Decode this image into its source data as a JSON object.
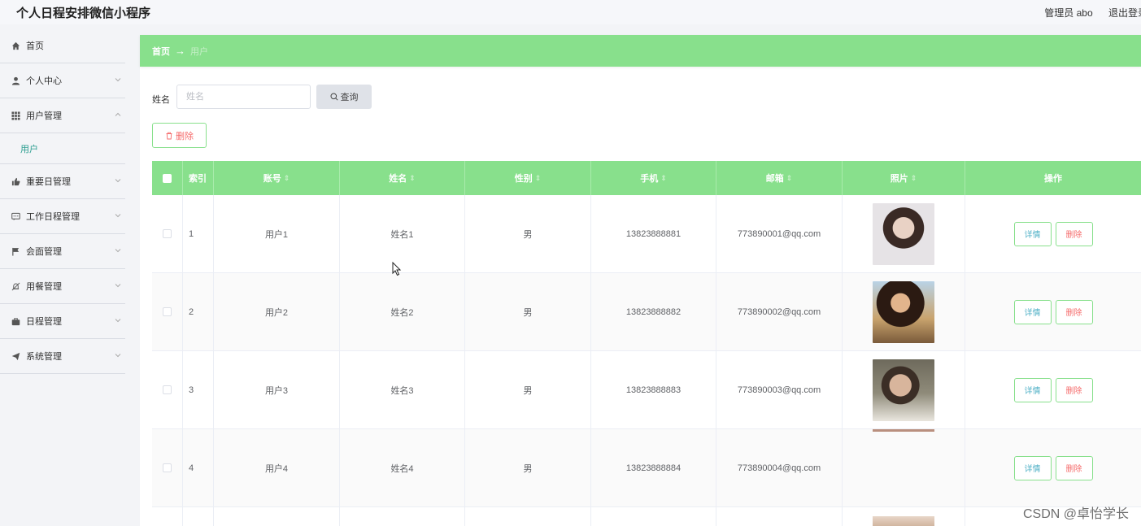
{
  "app": {
    "title": "个人日程安排微信小程序",
    "admin": "管理员 abo",
    "logout": "退出登录"
  },
  "sidebar": {
    "items": [
      {
        "label": "首页",
        "icon": "home-icon"
      },
      {
        "label": "个人中心",
        "icon": "user-icon"
      },
      {
        "label": "用户管理",
        "icon": "grid-icon",
        "expanded": true,
        "sub": [
          "用户"
        ]
      },
      {
        "label": "重要日管理",
        "icon": "thumb-icon"
      },
      {
        "label": "工作日程管理",
        "icon": "chat-icon"
      },
      {
        "label": "会面管理",
        "icon": "flag-icon"
      },
      {
        "label": "用餐管理",
        "icon": "bell-off-icon"
      },
      {
        "label": "日程管理",
        "icon": "briefcase-icon"
      },
      {
        "label": "系统管理",
        "icon": "send-icon"
      }
    ]
  },
  "breadcrumb": {
    "home": "首页",
    "arrow": "→",
    "current": "用户"
  },
  "search": {
    "label": "姓名",
    "placeholder": "姓名",
    "button": "查询"
  },
  "actions": {
    "delete": "删除"
  },
  "table": {
    "headers": [
      "索引",
      "账号",
      "姓名",
      "性别",
      "手机",
      "邮箱",
      "照片",
      "操作"
    ],
    "rows": [
      {
        "index": "1",
        "account": "用户1",
        "name": "姓名1",
        "gender": "男",
        "phone": "13823888881",
        "email": "773890001@qq.com",
        "photo": true
      },
      {
        "index": "2",
        "account": "用户2",
        "name": "姓名2",
        "gender": "男",
        "phone": "13823888882",
        "email": "773890002@qq.com",
        "photo": true
      },
      {
        "index": "3",
        "account": "用户3",
        "name": "姓名3",
        "gender": "男",
        "phone": "13823888883",
        "email": "773890003@qq.com",
        "photo": true
      },
      {
        "index": "4",
        "account": "用户4",
        "name": "姓名4",
        "gender": "男",
        "phone": "13823888884",
        "email": "773890004@qq.com",
        "photo": false
      }
    ],
    "row_actions": {
      "detail": "详情",
      "delete": "删除"
    }
  },
  "watermark": "CSDN @卓怡学长",
  "colors": {
    "accent": "#88e08c",
    "danger": "#f56c6c",
    "info": "#4fb0c6"
  }
}
